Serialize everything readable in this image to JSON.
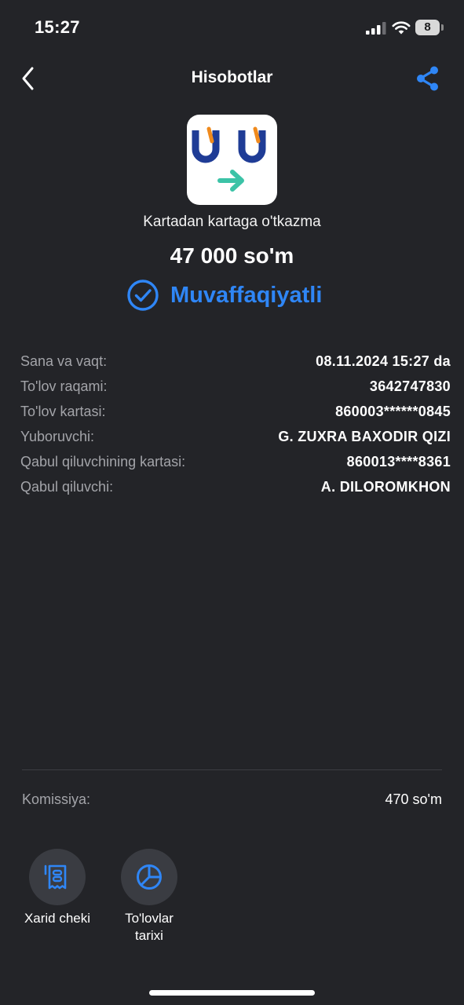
{
  "status_bar": {
    "time": "15:27",
    "battery_level": "8"
  },
  "nav": {
    "title": "Hisobotlar"
  },
  "transaction": {
    "type": "Kartadan kartaga o'tkazma",
    "amount": "47 000 so'm",
    "status": "Muvaffaqiyatli"
  },
  "details": [
    {
      "label": "Sana va vaqt:",
      "value": "08.11.2024 15:27 da"
    },
    {
      "label": "To'lov raqami:",
      "value": "3642747830"
    },
    {
      "label": "To'lov kartasi:",
      "value": "860003******0845"
    },
    {
      "label": "Yuboruvchi:",
      "value": "G. ZUXRA BAXODIR QIZI"
    },
    {
      "label": "Qabul qiluvchining kartasi:",
      "value": "860013****8361"
    },
    {
      "label": "Qabul qiluvchi:",
      "value": "A. DILOROMKHON"
    }
  ],
  "fee": {
    "label": "Komissiya:",
    "value": "470 so'm"
  },
  "actions": [
    {
      "label": "Xarid cheki",
      "icon": "receipt-icon"
    },
    {
      "label": "To'lovlar tarixi",
      "icon": "pie-chart-icon"
    }
  ],
  "colors": {
    "accent": "#2f86f6",
    "background": "#232428",
    "brand_blue": "#1f3c96",
    "brand_orange": "#f08a1c",
    "brand_green": "#3cc3a7"
  }
}
